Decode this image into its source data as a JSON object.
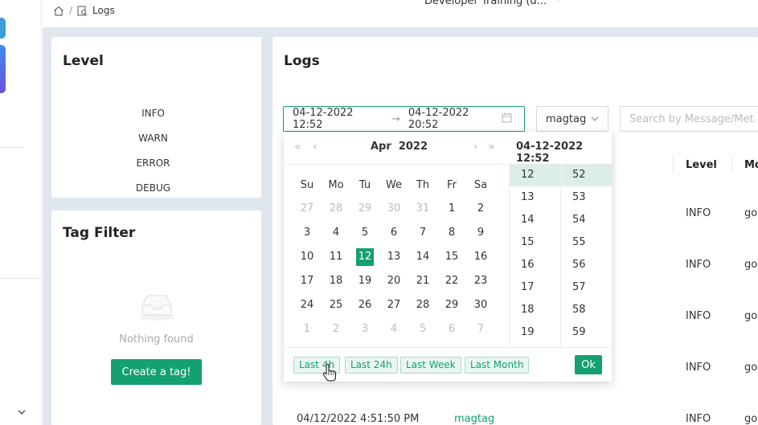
{
  "breadcrumb": {
    "current": "Logs"
  },
  "workspace": {
    "name": "Developer Training (d..."
  },
  "level_panel": {
    "title": "Level",
    "levels": [
      "INFO",
      "WARN",
      "ERROR",
      "DEBUG"
    ]
  },
  "tag_panel": {
    "title": "Tag Filter",
    "empty_text": "Nothing found",
    "create_button": "Create a tag!"
  },
  "logs": {
    "title": "Logs",
    "date_start": "04-12-2022 12:52",
    "date_arrow": "→",
    "date_end": "04-12-2022 20:52",
    "tag_select": "magtag",
    "search_placeholder": "Search by Message/Metadata",
    "columns": {
      "level": "Level",
      "message": "Mo"
    },
    "rows": [
      {
        "level": "INFO",
        "message": "go"
      },
      {
        "level": "INFO",
        "message": "go"
      },
      {
        "level": "INFO",
        "message": "go"
      },
      {
        "level": "INFO",
        "message": "go"
      },
      {
        "time": "04/12/2022 4:51:50 PM",
        "tag": "magtag",
        "level": "INFO",
        "message": "go"
      }
    ]
  },
  "picker": {
    "nav": {
      "prev_year": "«",
      "prev_month": "‹",
      "next_month": "›",
      "next_year": "»"
    },
    "month": "Apr",
    "year": "2022",
    "time_header": "04-12-2022 12:52",
    "weekdays": [
      "Su",
      "Mo",
      "Tu",
      "We",
      "Th",
      "Fr",
      "Sa"
    ],
    "weeks": [
      [
        "27",
        "28",
        "29",
        "30",
        "31",
        "1",
        "2"
      ],
      [
        "3",
        "4",
        "5",
        "6",
        "7",
        "8",
        "9"
      ],
      [
        "10",
        "11",
        "12",
        "13",
        "14",
        "15",
        "16"
      ],
      [
        "17",
        "18",
        "19",
        "20",
        "21",
        "22",
        "23"
      ],
      [
        "24",
        "25",
        "26",
        "27",
        "28",
        "29",
        "30"
      ],
      [
        "1",
        "2",
        "3",
        "4",
        "5",
        "6",
        "7"
      ]
    ],
    "selected_day": "12",
    "hours": [
      "12",
      "13",
      "14",
      "15",
      "16",
      "17",
      "18",
      "19"
    ],
    "minutes": [
      "52",
      "53",
      "54",
      "55",
      "56",
      "57",
      "58",
      "59"
    ],
    "presets": [
      "Last 4h",
      "Last 24h",
      "Last Week",
      "Last Month"
    ],
    "ok": "Ok"
  },
  "colors": {
    "accent": "#14a070",
    "background": "#dfe6ee"
  }
}
